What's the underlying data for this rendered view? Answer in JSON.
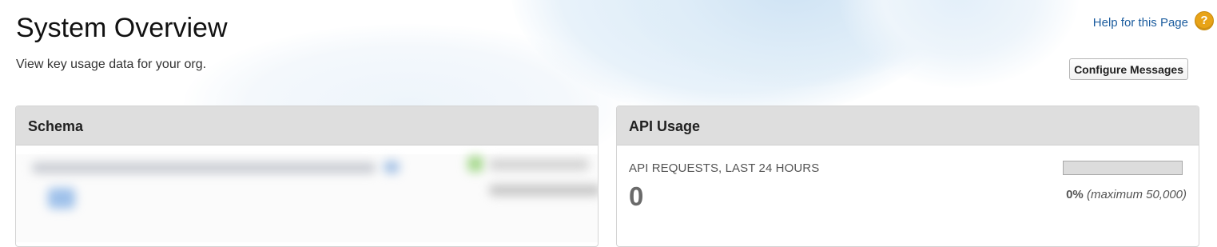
{
  "page": {
    "title": "System Overview",
    "description": "View key usage data for your org.",
    "help_link": "Help for this Page",
    "help_icon": "question-icon",
    "configure_button": "Configure Messages"
  },
  "panels": {
    "schema": {
      "title": "Schema"
    },
    "api_usage": {
      "title": "API Usage",
      "metric_label": "API REQUESTS, LAST 24 HOURS",
      "value": "0",
      "percent": "0%",
      "percent_fraction": 0,
      "maximum": "(maximum 50,000)"
    }
  },
  "colors": {
    "link": "#1b5c9e",
    "help_icon": "#e8a317",
    "panel_header": "#dedede",
    "usage_fill": "#3d9a3d"
  }
}
